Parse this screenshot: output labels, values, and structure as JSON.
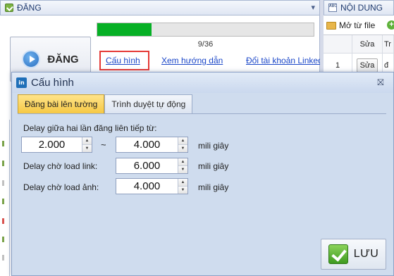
{
  "left_panel": {
    "title": "ĐĂNG",
    "collapse_glyph": "▾",
    "post_button_label": "ĐĂNG",
    "progress": {
      "fraction": 0.25,
      "text": "9/36",
      "fill_color": "#06b025"
    },
    "links": {
      "config": "Cấu hình",
      "guide": "Xem hướng dẫn",
      "switch_account": "Đổi tài khoản Linkedi"
    },
    "highlight_color": "#e53935"
  },
  "right_panel": {
    "title": "NỘI DUNG",
    "open_file_label": "Mở từ file",
    "plus_glyph": "+",
    "grid": {
      "headers": [
        "",
        "Sửa",
        "Tr"
      ],
      "rows": [
        {
          "index": "1",
          "edit": "Sửa",
          "content": "đ"
        }
      ]
    }
  },
  "dialog": {
    "app_icon_text": "in",
    "title": "Cấu hình",
    "close_glyph": "⛝",
    "tabs": [
      {
        "label": "Đăng bài lên tường",
        "active": true
      },
      {
        "label": "Trình duyệt tự động",
        "active": false
      }
    ],
    "form": {
      "delay_between_label": "Delay giữa hai lần đăng liên tiếp từ:",
      "delay_min_value": "2.000",
      "range_separator": "~",
      "delay_max_value": "4.000",
      "unit": "mili giây",
      "link_load_label": "Delay chờ load link:",
      "link_load_value": "6.000",
      "image_load_label": "Delay chờ load ảnh:",
      "image_load_value": "4.000",
      "up_arrow": "▲",
      "down_arrow": "▼"
    },
    "save_label": "LƯU"
  }
}
